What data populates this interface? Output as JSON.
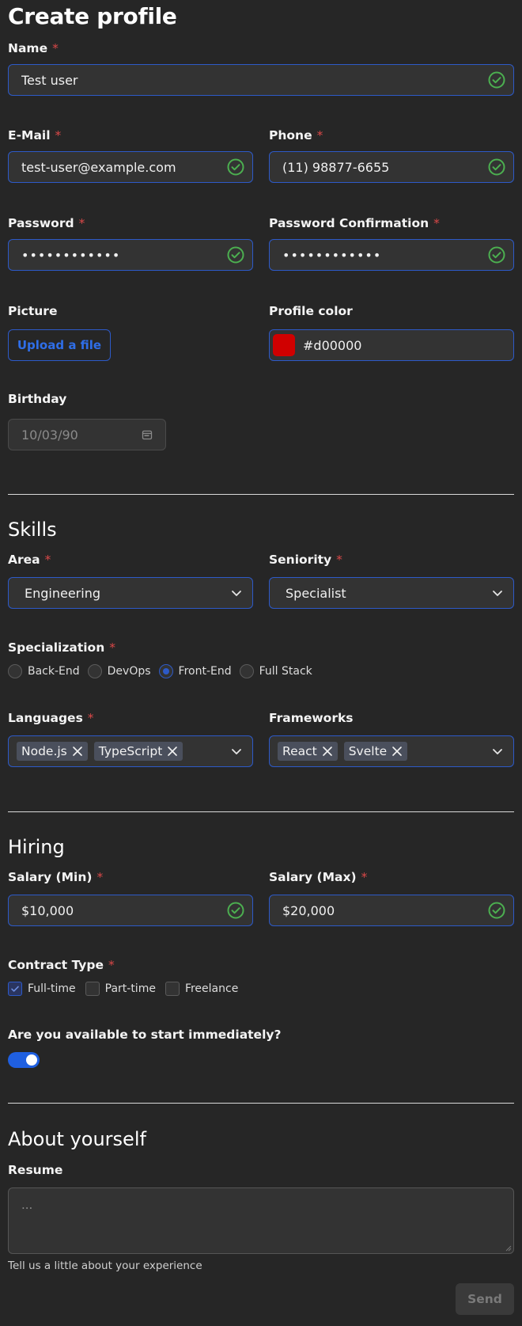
{
  "page_title": "Create profile",
  "required_mark": "*",
  "fields": {
    "name": {
      "label": "Name",
      "value": "Test user"
    },
    "email": {
      "label": "E-Mail",
      "value": "test-user@example.com"
    },
    "phone": {
      "label": "Phone",
      "value": "(11) 98877-6655"
    },
    "password": {
      "label": "Password",
      "value": "••••••••••••"
    },
    "password_confirmation": {
      "label": "Password Confirmation",
      "value": "••••••••••••"
    },
    "picture": {
      "label": "Picture",
      "button": "Upload a file"
    },
    "profile_color": {
      "label": "Profile color",
      "value": "#d00000"
    },
    "birthday": {
      "label": "Birthday",
      "value": "10/03/90"
    }
  },
  "skills": {
    "title": "Skills",
    "area": {
      "label": "Area",
      "value": "Engineering"
    },
    "seniority": {
      "label": "Seniority",
      "value": "Specialist"
    },
    "specialization": {
      "label": "Specialization",
      "options": [
        "Back-End",
        "DevOps",
        "Front-End",
        "Full Stack"
      ],
      "selected": "Front-End"
    },
    "languages": {
      "label": "Languages",
      "chips": [
        "Node.js",
        "TypeScript"
      ]
    },
    "frameworks": {
      "label": "Frameworks",
      "chips": [
        "React",
        "Svelte"
      ]
    }
  },
  "hiring": {
    "title": "Hiring",
    "salary_min": {
      "label": "Salary (Min)",
      "value": "$10,000"
    },
    "salary_max": {
      "label": "Salary (Max)",
      "value": "$20,000"
    },
    "contract_type": {
      "label": "Contract Type",
      "options": [
        "Full-time",
        "Part-time",
        "Freelance"
      ],
      "checked": [
        "Full-time"
      ]
    },
    "availability": {
      "label": "Are you available to start immediately?",
      "on": true
    }
  },
  "about": {
    "title": "About yourself",
    "resume": {
      "label": "Resume",
      "placeholder": "...",
      "hint": "Tell us a little about your experience"
    }
  },
  "send_button": "Send",
  "colors": {
    "background": "#262626",
    "input_bg": "#333333",
    "accent": "#2d5ac8",
    "valid": "#4caf50",
    "required": "#d94848",
    "profile_color": "#d00000"
  }
}
